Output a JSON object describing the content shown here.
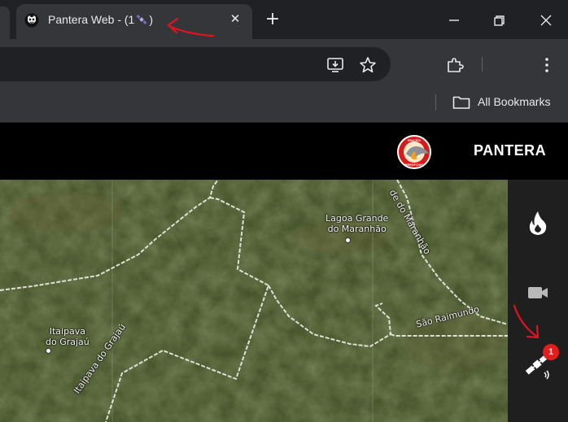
{
  "browser": {
    "tab": {
      "title": "Pantera Web - (1",
      "title_suffix": ")",
      "close_glyph": "✕"
    },
    "new_tab_glyph": "+",
    "bookmarks": {
      "all_bookmarks_label": "All Bookmarks"
    }
  },
  "app": {
    "title": "PANTERA",
    "logo_text_top": "IRAÇÃO",
    "logo_text_bottom": "PREVFOGO"
  },
  "map": {
    "labels": {
      "lagoa_line1": "Lagoa Grande",
      "lagoa_line2": "do Maranhão",
      "itaipava_line1": "Itaipava",
      "itaipava_line2": "do Grajaú",
      "rio_grajau": "Itaipava do Grajaú",
      "rio_maranhao": "de do Maranhão",
      "sao_raimundo": "São Raimundo"
    }
  },
  "sidebar": {
    "items": [
      {
        "name": "fire",
        "icon": "fire-icon"
      },
      {
        "name": "camera",
        "icon": "video-camera-icon"
      },
      {
        "name": "satellite",
        "icon": "satellite-icon",
        "badge": "1"
      }
    ]
  },
  "colors": {
    "header_bg": "#000000",
    "sidebar_bg": "#1f1f1f",
    "badge": "#e21d1d",
    "annotation": "#e0141e"
  }
}
